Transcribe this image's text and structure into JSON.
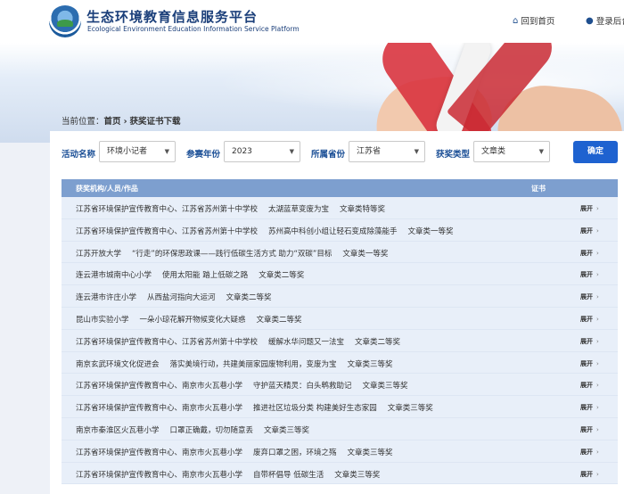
{
  "header": {
    "title": "生态环境教育信息服务平台",
    "subtitle": "Ecological Environment Education Information Service Platform",
    "nav_home": "回到首页",
    "nav_user": "登录后台"
  },
  "breadcrumb": {
    "prefix": "当前位置：",
    "home": "首页",
    "separator": "›",
    "current": "获奖证书下载"
  },
  "filters": {
    "activity_label": "活动名称",
    "activity_value": "环境小记者",
    "year_label": "参赛年份",
    "year_value": "2023",
    "province_label": "所属省份",
    "province_value": "江苏省",
    "award_label": "获奖类型",
    "award_value": "文章类",
    "submit": "确定"
  },
  "table": {
    "col_org": "获奖机构/人员/作品",
    "col_cert": "证书",
    "expand_label": "展开",
    "rows": [
      [
        "江苏省环境保护宣传教育中心、江苏省苏州第十中学校",
        "太湖蓝草变废为宝",
        "文章类特等奖"
      ],
      [
        "江苏省环境保护宣传教育中心、江苏省苏州第十中学校",
        "苏州高中科创小组让轻石变成除藻能手",
        "文章类一等奖"
      ],
      [
        "江苏开放大学",
        "“行走”的环保思政课——践行低碳生活方式 助力“双碳”目标",
        "文章类一等奖"
      ],
      [
        "连云港市城南中心小学",
        "使用太阳能 踏上低碳之路",
        "文章类二等奖"
      ],
      [
        "连云港市许庄小学",
        "从西盐河指向大运河",
        "文章类二等奖"
      ],
      [
        "昆山市实验小学",
        "一朵小琼花解开物候变化大疑惑",
        "文章类二等奖"
      ],
      [
        "江苏省环境保护宣传教育中心、江苏省苏州第十中学校",
        "缓解水华问题又一法宝",
        "文章类二等奖"
      ],
      [
        "南京玄武环境文化促进会",
        "落实美境行动，共建美丽家园废物利用，变废为宝",
        "文章类三等奖"
      ],
      [
        "江苏省环境保护宣传教育中心、南京市火瓦巷小学",
        "守护蓝天精灵：白头鹎救助记",
        "文章类三等奖"
      ],
      [
        "江苏省环境保护宣传教育中心、南京市火瓦巷小学",
        "推进社区垃圾分类 构建美好生态家园",
        "文章类三等奖"
      ],
      [
        "南京市秦淮区火瓦巷小学",
        "口罩正确戴，切勿随意丢",
        "文章类三等奖"
      ],
      [
        "江苏省环境保护宣传教育中心、南京市火瓦巷小学",
        "废弃口罩之困，环境之殇",
        "文章类三等奖"
      ],
      [
        "江苏省环境保护宣传教育中心、南京市火瓦巷小学",
        "自带杯倡导 低碳生活",
        "文章类三等奖"
      ]
    ]
  },
  "colors": {
    "brand": "#1b3f7a",
    "accent": "#1e62d0",
    "table_header": "#7d9fcf",
    "row_bg": "#e8eff9"
  }
}
